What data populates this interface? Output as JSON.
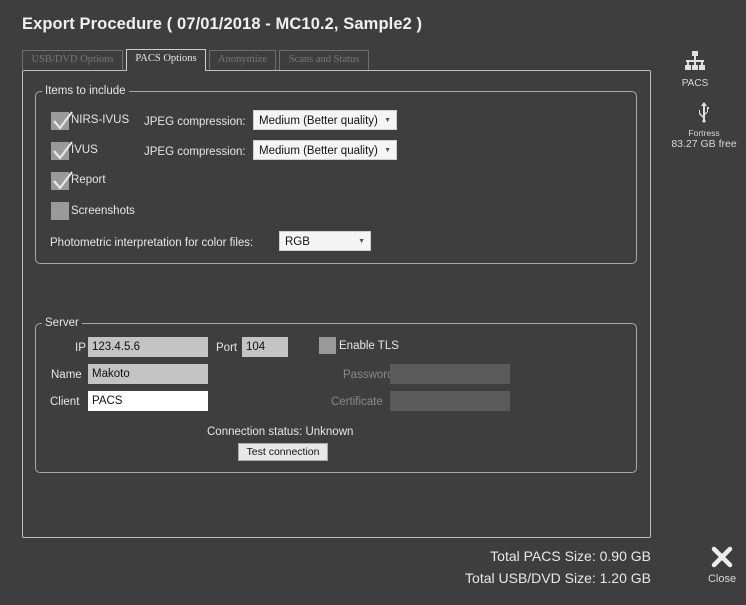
{
  "window": {
    "title": "Export Procedure  ( 07/01/2018 - MC10.2, Sample2 )"
  },
  "tabs": [
    {
      "label": "USB/DVD Options",
      "active": false
    },
    {
      "label": "PACS Options",
      "active": true
    },
    {
      "label": "Anonymize",
      "active": false
    },
    {
      "label": "Scans and Status",
      "active": false
    }
  ],
  "items_group": {
    "legend": "Items to include",
    "items": [
      {
        "label": "NIRS-IVUS",
        "checked": true,
        "compression_label": "JPEG compression:",
        "compression_value": "Medium (Better quality)"
      },
      {
        "label": "IVUS",
        "checked": true,
        "compression_label": "JPEG compression:",
        "compression_value": "Medium (Better quality)"
      },
      {
        "label": "Report",
        "checked": true
      },
      {
        "label": "Screenshots",
        "checked": false
      }
    ],
    "photometric_label": "Photometric interpretation for color files:",
    "photometric_value": "RGB"
  },
  "server_group": {
    "legend": "Server",
    "ip_label": "IP",
    "ip_value": "123.4.5.6",
    "port_label": "Port",
    "port_value": "104",
    "tls_label": "Enable TLS",
    "tls_checked": false,
    "name_label": "Name",
    "name_value": "Makoto",
    "password_label": "Password",
    "client_label": "Client",
    "client_value": "PACS",
    "certificate_label": "Certificate",
    "connection_status": "Connection status: Unknown",
    "test_button": "Test connection"
  },
  "sidebar": {
    "pacs_label": "PACS",
    "fortress_label": "Fortress",
    "fortress_free": "83.27 GB free",
    "close_label": "Close"
  },
  "totals": {
    "pacs": "Total PACS Size: 0.90 GB",
    "usb": "Total USB/DVD Size: 1.20 GB"
  },
  "icons": {
    "network": "network-icon",
    "usb": "usb-icon",
    "close": "close-x-icon",
    "check": "checkmark-icon"
  },
  "colors": {
    "background": "#3e3e3e",
    "text": "#e6e6e6",
    "checkbox": "#9a9a9a"
  }
}
